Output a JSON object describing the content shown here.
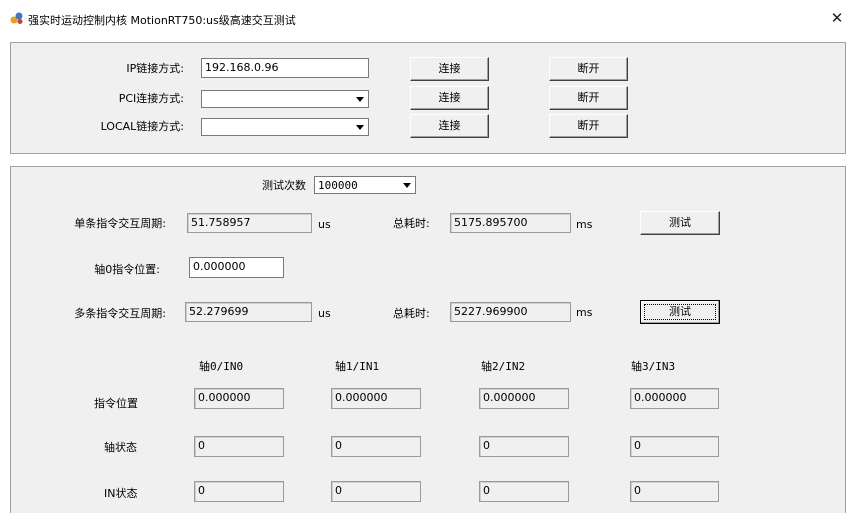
{
  "window": {
    "title": "强实时运动控制内核 MotionRT750:us级高速交互测试"
  },
  "connection": {
    "ip": {
      "label": "IP链接方式:",
      "value": "192.168.0.96",
      "connect": "连接",
      "disconnect": "断开"
    },
    "pci": {
      "label": "PCI连接方式:",
      "value": "",
      "connect": "连接",
      "disconnect": "断开"
    },
    "local": {
      "label": "LOCAL链接方式:",
      "value": "",
      "connect": "连接",
      "disconnect": "断开"
    }
  },
  "test": {
    "count_label": "测试次数",
    "count_value": "100000",
    "single": {
      "label": "单条指令交互周期:",
      "value": "51.758957",
      "unit": "us",
      "total_label": "总耗时:",
      "total_value": "5175.895700",
      "total_unit": "ms",
      "button": "测试"
    },
    "axis0": {
      "label": "轴0指令位置:",
      "value": "0.000000"
    },
    "multi": {
      "label": "多条指令交互周期:",
      "value": "52.279699",
      "unit": "us",
      "total_label": "总耗时:",
      "total_value": "5227.969900",
      "total_unit": "ms",
      "button": "测试"
    }
  },
  "grid": {
    "columns": [
      "轴0/IN0",
      "轴1/IN1",
      "轴2/IN2",
      "轴3/IN3"
    ],
    "rows": [
      {
        "label": "指令位置",
        "values": [
          "0.000000",
          "0.000000",
          "0.000000",
          "0.000000"
        ]
      },
      {
        "label": "轴状态",
        "values": [
          "0",
          "0",
          "0",
          "0"
        ]
      },
      {
        "label": "IN状态",
        "values": [
          "0",
          "0",
          "0",
          "0"
        ]
      }
    ]
  }
}
